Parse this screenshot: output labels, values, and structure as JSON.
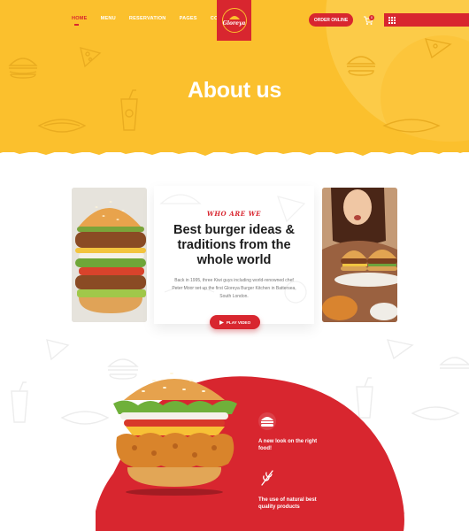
{
  "nav": {
    "items": [
      {
        "label": "HOME",
        "active": true
      },
      {
        "label": "MENU",
        "active": false
      },
      {
        "label": "RESERVATION",
        "active": false
      },
      {
        "label": "PAGES",
        "active": false
      },
      {
        "label": "CONTACT",
        "active": false
      }
    ]
  },
  "logo": {
    "text": "Gloreya"
  },
  "header": {
    "order_label": "ORDER ONLINE",
    "cart_count": "0",
    "cart_icon": "cart-icon",
    "menu_icon": "grid-menu-icon"
  },
  "hero": {
    "title": "About us"
  },
  "about": {
    "eyebrow": "WHO ARE WE",
    "title": "Best burger ideas & traditions from the whole world",
    "text": "Back in 1995, three Kiwi guys including world-renowned chef Peter Moor set up the first Gloreya Burger Kitchen in Battersea, South London.",
    "play_label": "PLAY VIDEO",
    "play_icon": "play-icon"
  },
  "features": [
    {
      "icon": "burger-icon",
      "text": "A new look on the right food!"
    },
    {
      "icon": "wheat-icon",
      "text": "The use of natural best quality products"
    }
  ],
  "colors": {
    "accent": "#d8262f",
    "yellow": "#fbc02d"
  }
}
